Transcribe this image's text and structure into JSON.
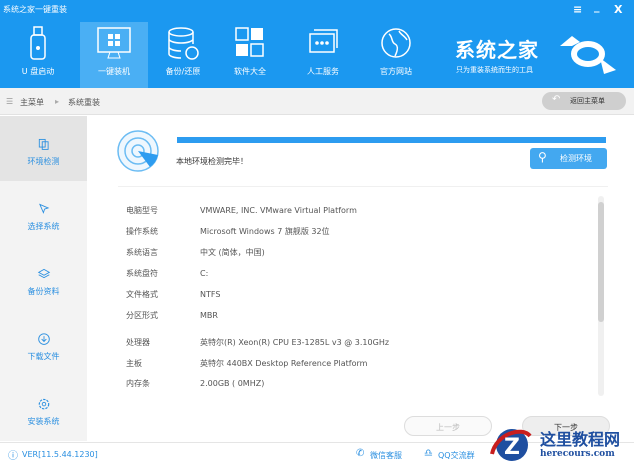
{
  "window": {
    "title": "系统之家一键重装",
    "menu_icon": "≡",
    "minimize_icon": "_",
    "close_icon": "X"
  },
  "nav": [
    {
      "label": "U 盘启动"
    },
    {
      "label": "一键装机"
    },
    {
      "label": "备份/还原"
    },
    {
      "label": "软件大全"
    },
    {
      "label": "人工服务"
    },
    {
      "label": "官方网站"
    }
  ],
  "brand": {
    "name": "系统之家",
    "slogan": "只为重装系统而生的工具"
  },
  "breadcrumb": {
    "root": "主菜单",
    "current": "系统重装",
    "back": "返回主菜单"
  },
  "sidebar": [
    {
      "label": "环境检测"
    },
    {
      "label": "选择系统"
    },
    {
      "label": "备份资料"
    },
    {
      "label": "下载文件"
    },
    {
      "label": "安装系统"
    }
  ],
  "detect": {
    "progress": 100,
    "status": "本地环境检测完毕！",
    "button": "检测环境"
  },
  "info": [
    {
      "k": "电脑型号",
      "v": "VMWARE, INC. VMware Virtual Platform"
    },
    {
      "k": "操作系统",
      "v": "Microsoft Windows 7 旗舰版  32位"
    },
    {
      "k": "系统语言",
      "v": "中文 (简体，中国)"
    },
    {
      "k": "系统盘符",
      "v": "C:"
    },
    {
      "k": "文件格式",
      "v": "NTFS"
    },
    {
      "k": "分区形式",
      "v": "MBR"
    },
    {
      "k": "处理器",
      "v": "英特尔(R) Xeon(R) CPU E3-1285L v3 @ 3.10GHz"
    },
    {
      "k": "主板",
      "v": "英特尔 440BX Desktop Reference Platform"
    },
    {
      "k": "内存条",
      "v": "2.00GB ( 0MHZ)"
    }
  ],
  "buttons": {
    "prev": "上一步",
    "next": "下一步"
  },
  "footer": {
    "version": "VER[11.5.44.1230]",
    "wechat": "微信客服",
    "qq": "QQ交流群"
  },
  "watermark": {
    "title": "这里教程网",
    "url": "herecours.com"
  }
}
